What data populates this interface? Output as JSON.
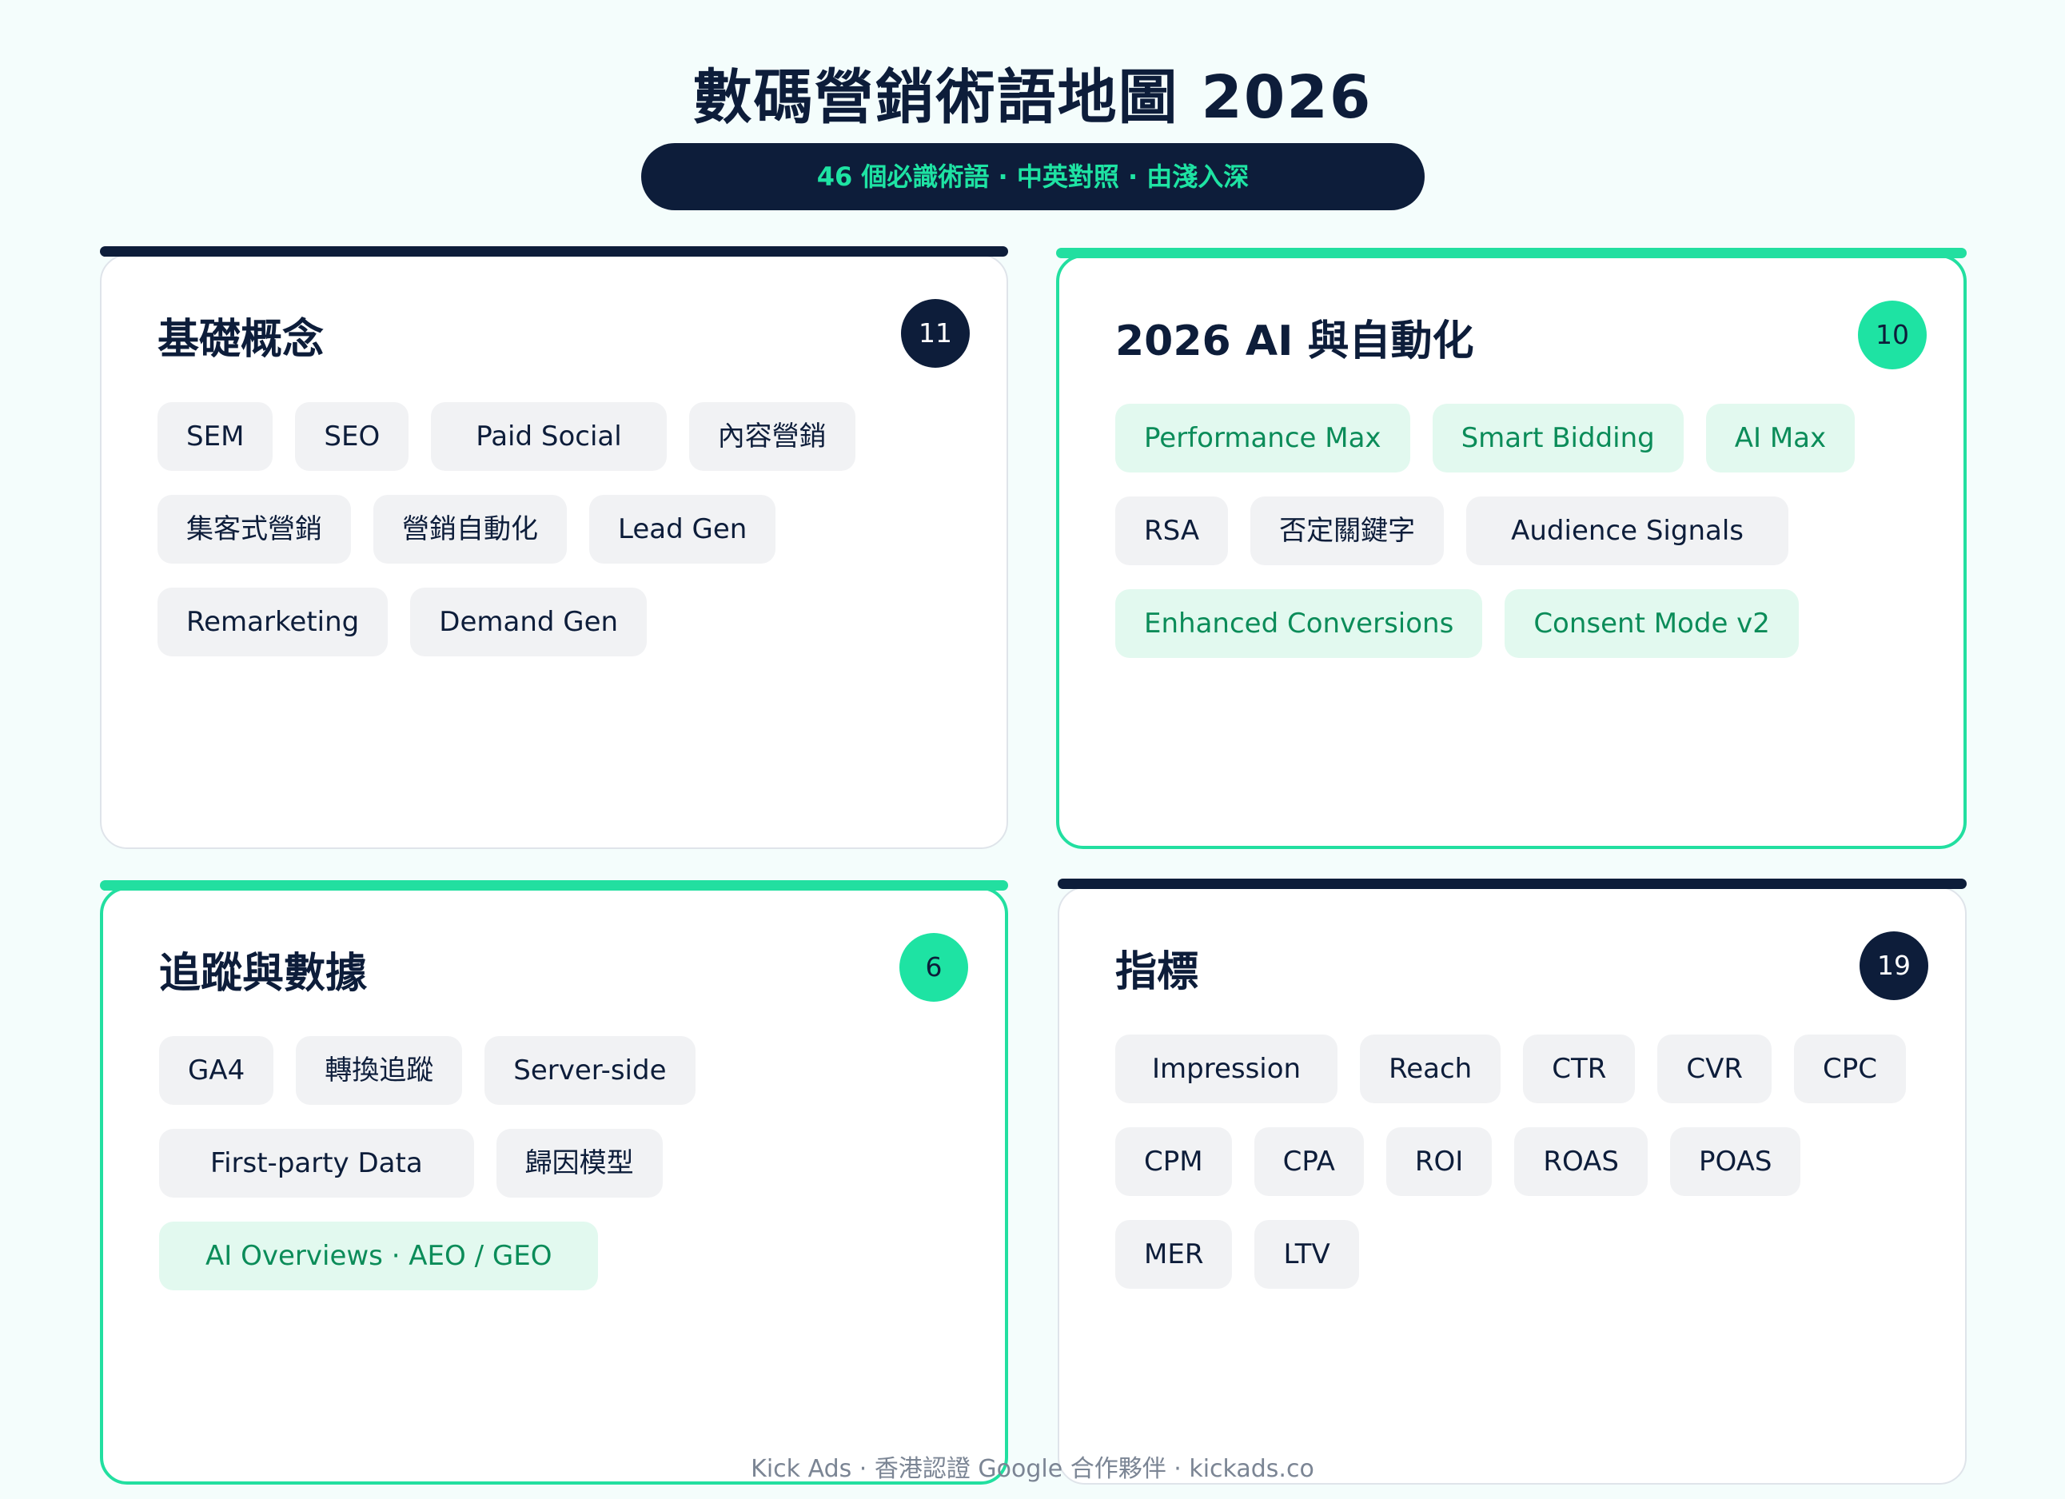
{
  "title": "數碼營銷術語地圖 2026",
  "subtitle": "46 個必識術語 · 中英對照 · 由淺入深",
  "sections": [
    {
      "title": "基礎概念",
      "count": "11",
      "tags": [
        "SEM",
        "SEO",
        "Paid Social",
        "內容營銷",
        "集客式營銷",
        "營銷自動化",
        "Lead Gen",
        "Remarketing",
        "Demand Gen"
      ]
    },
    {
      "title": "2026 AI 與自動化",
      "count": "10",
      "tags": [
        "Performance Max",
        "Smart Bidding",
        "AI Max",
        "RSA",
        "否定關鍵字",
        "Audience Signals",
        "Enhanced Conversions",
        "Consent Mode v2"
      ]
    },
    {
      "title": "追蹤與數據",
      "count": "6",
      "tags": [
        "GA4",
        "轉換追蹤",
        "Server-side",
        "First-party Data",
        "歸因模型",
        "AI Overviews · AEO / GEO"
      ]
    },
    {
      "title": "指標",
      "count": "19",
      "tags": [
        "Impression",
        "Reach",
        "CTR",
        "CVR",
        "CPC",
        "CPM",
        "CPA",
        "ROI",
        "ROAS",
        "POAS",
        "MER",
        "LTV"
      ]
    }
  ],
  "footer": "Kick Ads · 香港認證 Google 合作夥伴 · kickads.co",
  "colors": {
    "navy": "#0d1d3a",
    "accent_green": "#1ee3a3",
    "tag_green_text": "#0b8c59",
    "tag_green_bg": "#e2f9ef",
    "tag_grey_bg": "#f1f2f4"
  }
}
